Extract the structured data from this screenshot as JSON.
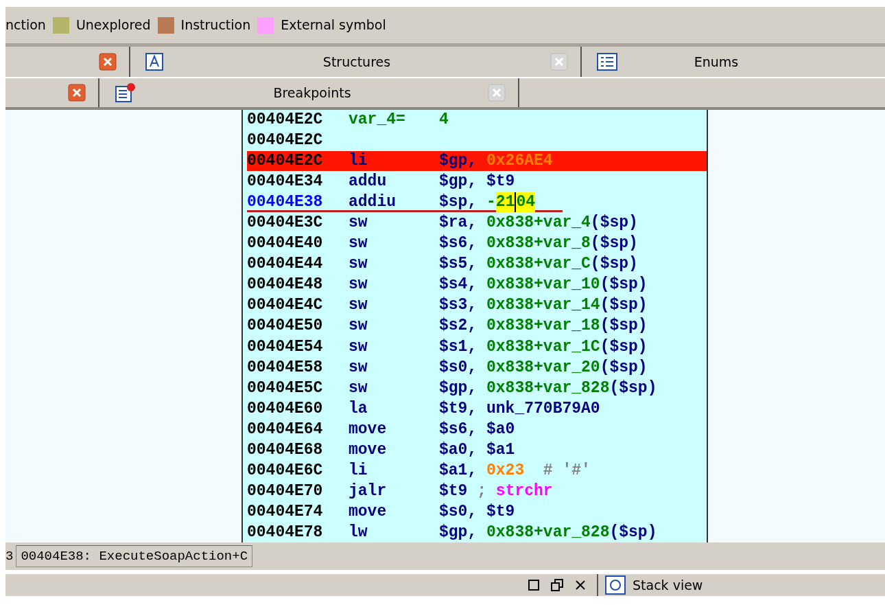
{
  "legend": [
    {
      "label": "nction"
    },
    {
      "label": "Unexplored",
      "color": "#b5b56a"
    },
    {
      "label": "Instruction",
      "color": "#b87a52"
    },
    {
      "label": "External symbol",
      "color": "#ff9fff"
    }
  ],
  "tab_rows": [
    [
      {
        "kind": "cut",
        "selected": true
      },
      {
        "kind": "structures",
        "label": "Structures",
        "selected": false
      },
      {
        "kind": "enums",
        "label": "Enums"
      }
    ],
    [
      {
        "kind": "cut",
        "selected": true
      },
      {
        "kind": "breakpoints",
        "label": "Breakpoints",
        "selected": false
      }
    ]
  ],
  "listing": {
    "rows": [
      {
        "kind": "stackvar",
        "address": "00404E2C",
        "mnemonic": "var_4=",
        "operands": [
          {
            "text": "4",
            "kind": "num"
          }
        ],
        "breakpoint": false,
        "current": false
      },
      {
        "kind": "label",
        "address": "00404E2C",
        "operands": [],
        "breakpoint": false,
        "current": false
      },
      {
        "kind": "instr",
        "address": "00404E2C",
        "mnemonic": "li",
        "operands": [
          {
            "text": "$gp, ",
            "kind": "reg"
          },
          {
            "text": "0x26AE4",
            "kind": "imm"
          }
        ],
        "breakpoint": true,
        "current": false
      },
      {
        "kind": "instr",
        "address": "00404E34",
        "mnemonic": "addu",
        "operands": [
          {
            "text": "$gp, $t9",
            "kind": "reg"
          }
        ],
        "breakpoint": false,
        "current": false
      },
      {
        "kind": "instr",
        "address": "00404E38",
        "mnemonic": "addiu",
        "operands": [
          {
            "text": "$sp, ",
            "kind": "reg"
          },
          {
            "text": "-",
            "kind": "num"
          },
          {
            "text": "21",
            "kind": "num",
            "highlighted": true
          },
          {
            "text": "04",
            "kind": "num",
            "highlighted": true,
            "cursor": true
          }
        ],
        "breakpoint": false,
        "current": true
      },
      {
        "kind": "instr",
        "address": "00404E3C",
        "mnemonic": "sw",
        "operands": [
          {
            "text": "$ra, ",
            "kind": "reg"
          },
          {
            "text": "0x838+var_4",
            "kind": "num"
          },
          {
            "text": "($sp)",
            "kind": "reg"
          }
        ],
        "breakpoint": false,
        "current": false
      },
      {
        "kind": "instr",
        "address": "00404E40",
        "mnemonic": "sw",
        "operands": [
          {
            "text": "$s6, ",
            "kind": "reg"
          },
          {
            "text": "0x838+var_8",
            "kind": "num"
          },
          {
            "text": "($sp)",
            "kind": "reg"
          }
        ],
        "breakpoint": false,
        "current": false
      },
      {
        "kind": "instr",
        "address": "00404E44",
        "mnemonic": "sw",
        "operands": [
          {
            "text": "$s5, ",
            "kind": "reg"
          },
          {
            "text": "0x838+var_C",
            "kind": "num"
          },
          {
            "text": "($sp)",
            "kind": "reg"
          }
        ],
        "breakpoint": false,
        "current": false
      },
      {
        "kind": "instr",
        "address": "00404E48",
        "mnemonic": "sw",
        "operands": [
          {
            "text": "$s4, ",
            "kind": "reg"
          },
          {
            "text": "0x838+var_10",
            "kind": "num"
          },
          {
            "text": "($sp)",
            "kind": "reg"
          }
        ],
        "breakpoint": false,
        "current": false
      },
      {
        "kind": "instr",
        "address": "00404E4C",
        "mnemonic": "sw",
        "operands": [
          {
            "text": "$s3, ",
            "kind": "reg"
          },
          {
            "text": "0x838+var_14",
            "kind": "num"
          },
          {
            "text": "($sp)",
            "kind": "reg"
          }
        ],
        "breakpoint": false,
        "current": false
      },
      {
        "kind": "instr",
        "address": "00404E50",
        "mnemonic": "sw",
        "operands": [
          {
            "text": "$s2, ",
            "kind": "reg"
          },
          {
            "text": "0x838+var_18",
            "kind": "num"
          },
          {
            "text": "($sp)",
            "kind": "reg"
          }
        ],
        "breakpoint": false,
        "current": false
      },
      {
        "kind": "instr",
        "address": "00404E54",
        "mnemonic": "sw",
        "operands": [
          {
            "text": "$s1, ",
            "kind": "reg"
          },
          {
            "text": "0x838+var_1C",
            "kind": "num"
          },
          {
            "text": "($sp)",
            "kind": "reg"
          }
        ],
        "breakpoint": false,
        "current": false
      },
      {
        "kind": "instr",
        "address": "00404E58",
        "mnemonic": "sw",
        "operands": [
          {
            "text": "$s0, ",
            "kind": "reg"
          },
          {
            "text": "0x838+var_20",
            "kind": "num"
          },
          {
            "text": "($sp)",
            "kind": "reg"
          }
        ],
        "breakpoint": false,
        "current": false
      },
      {
        "kind": "instr",
        "address": "00404E5C",
        "mnemonic": "sw",
        "operands": [
          {
            "text": "$gp, ",
            "kind": "reg"
          },
          {
            "text": "0x838+var_828",
            "kind": "num"
          },
          {
            "text": "($sp)",
            "kind": "reg"
          }
        ],
        "breakpoint": false,
        "current": false
      },
      {
        "kind": "instr",
        "address": "00404E60",
        "mnemonic": "la",
        "operands": [
          {
            "text": "$t9, unk_770B79A0",
            "kind": "reg"
          }
        ],
        "breakpoint": false,
        "current": false
      },
      {
        "kind": "instr",
        "address": "00404E64",
        "mnemonic": "move",
        "operands": [
          {
            "text": "$s6, $a0",
            "kind": "reg"
          }
        ],
        "breakpoint": false,
        "current": false
      },
      {
        "kind": "instr",
        "address": "00404E68",
        "mnemonic": "move",
        "operands": [
          {
            "text": "$a0, $a1",
            "kind": "reg"
          }
        ],
        "breakpoint": false,
        "current": false
      },
      {
        "kind": "instr",
        "address": "00404E6C",
        "mnemonic": "li",
        "operands": [
          {
            "text": "$a1, ",
            "kind": "reg"
          },
          {
            "text": "0x23",
            "kind": "imm"
          },
          {
            "text": "  # '#'",
            "kind": "comment"
          }
        ],
        "breakpoint": false,
        "current": false
      },
      {
        "kind": "instr",
        "address": "00404E70",
        "mnemonic": "jalr",
        "operands": [
          {
            "text": "$t9 ",
            "kind": "reg"
          },
          {
            "text": "; ",
            "kind": "comment"
          },
          {
            "text": "strchr",
            "kind": "func"
          }
        ],
        "breakpoint": false,
        "current": false
      },
      {
        "kind": "instr",
        "address": "00404E74",
        "mnemonic": "move",
        "operands": [
          {
            "text": "$s0, $t9",
            "kind": "reg"
          }
        ],
        "breakpoint": false,
        "current": false
      },
      {
        "kind": "instr",
        "address": "00404E78",
        "mnemonic": "lw",
        "operands": [
          {
            "text": "$gp, ",
            "kind": "reg"
          },
          {
            "text": "0x838+var_828",
            "kind": "num"
          },
          {
            "text": "($sp)",
            "kind": "reg"
          }
        ],
        "breakpoint": false,
        "current": false
      }
    ]
  },
  "status_bar": {
    "prefix": "3",
    "location": "00404E38: ExecuteSoapAction+C"
  },
  "bottom_bar": {
    "tab": "Stack view"
  }
}
